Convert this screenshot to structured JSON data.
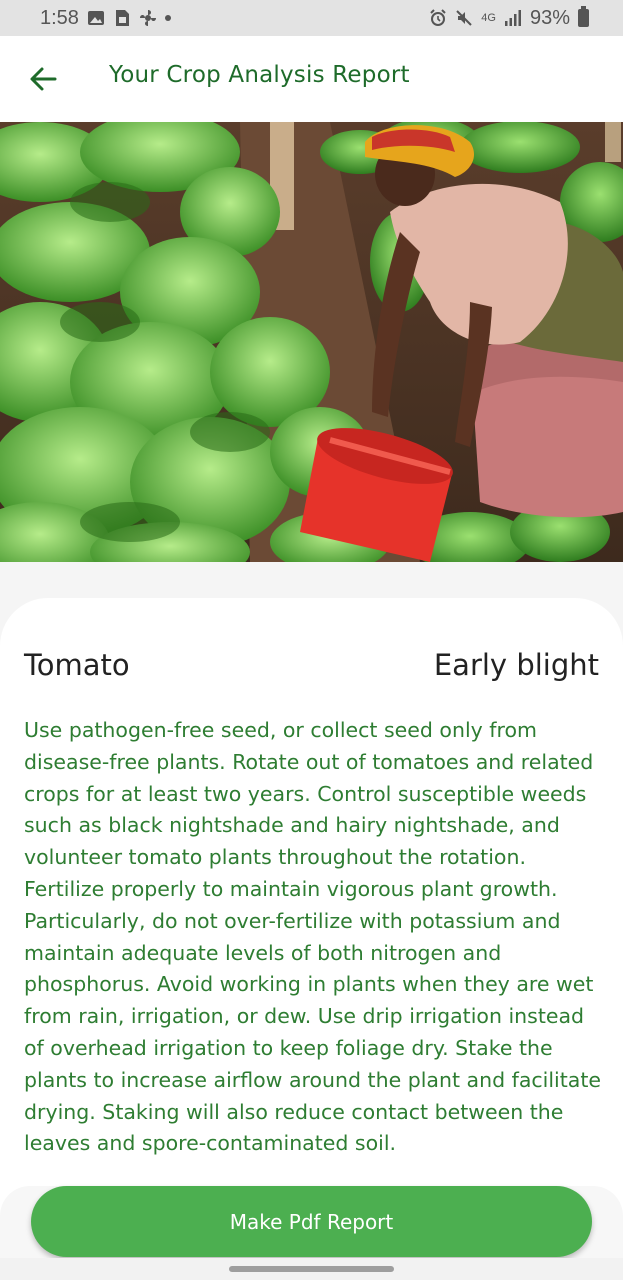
{
  "status_bar": {
    "time": "1:58",
    "network": "4G",
    "battery": "93%",
    "icons": [
      "gallery-icon",
      "sim-icon",
      "fan-icon",
      "dot",
      "alarm-icon",
      "mute-icon",
      "data-icon",
      "signal-icon",
      "battery-icon"
    ]
  },
  "app_bar": {
    "title": "Your Crop Analysis Report",
    "back_icon": "arrow-left-icon"
  },
  "hero": {
    "subject": "Farmer watering leafy crops with a red bucket"
  },
  "report": {
    "crop": "Tomato",
    "disease": "Early blight",
    "description": "Use pathogen-free seed, or collect seed only from disease-free plants. Rotate out of tomatoes and related crops for at least two years. Control susceptible weeds such as black nightshade and hairy nightshade, and volunteer tomato plants throughout the rotation. Fertilize properly to maintain vigorous plant growth. Particularly, do not over-fertilize with potassium and maintain adequate levels of both nitrogen and phosphorus. Avoid working in plants when they are wet from rain, irrigation, or dew. Use drip irrigation instead of overhead irrigation to keep foliage dry. Stake the plants to increase airflow around the plant and facilitate drying. Staking will also reduce contact between the leaves and spore-contaminated soil."
  },
  "actions": {
    "pdf_button": "Make Pdf Report"
  },
  "colors": {
    "accent": "#4caf50",
    "title_green": "#1e6b2a",
    "text_green": "#2e7d32"
  }
}
